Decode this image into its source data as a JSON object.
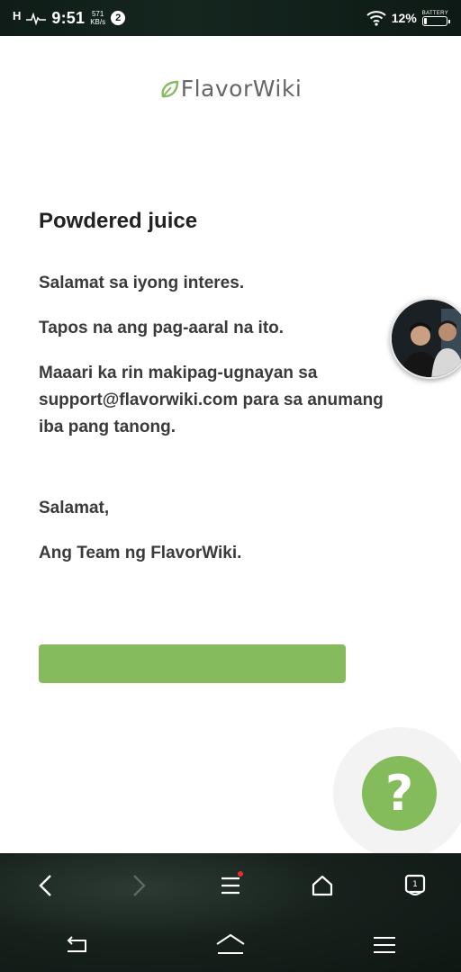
{
  "status_bar": {
    "net_indicator": "H",
    "time": "9:51",
    "speed_value": "571",
    "speed_unit": "KB/s",
    "notification_count": "2",
    "battery_percent": "12%",
    "battery_label": "BATTERY",
    "battery_level": 0.12
  },
  "header": {
    "logo_text": "FlavorWiki",
    "logo_color": "#85bb5c"
  },
  "content": {
    "title": "Powdered juice",
    "p1": "Salamat sa iyong interes.",
    "p2": "Tapos na ang pag-aaral na ito.",
    "p3": "Maaari ka rin makipag-ugnayan sa support@flavorwiki.com para sa anumang iba pang tanong.",
    "p4": "Salamat,",
    "p5": "Ang Team ng FlavorWiki."
  },
  "cta": {
    "label": "",
    "color": "#85bb5c"
  },
  "help_button": {
    "label": "?"
  },
  "icons": {
    "browser_nav": [
      "back-icon",
      "forward-icon",
      "menu-icon",
      "home-icon",
      "tabs-icon"
    ],
    "system_nav": [
      "system-back-icon",
      "system-home-icon",
      "system-menu-icon"
    ]
  }
}
